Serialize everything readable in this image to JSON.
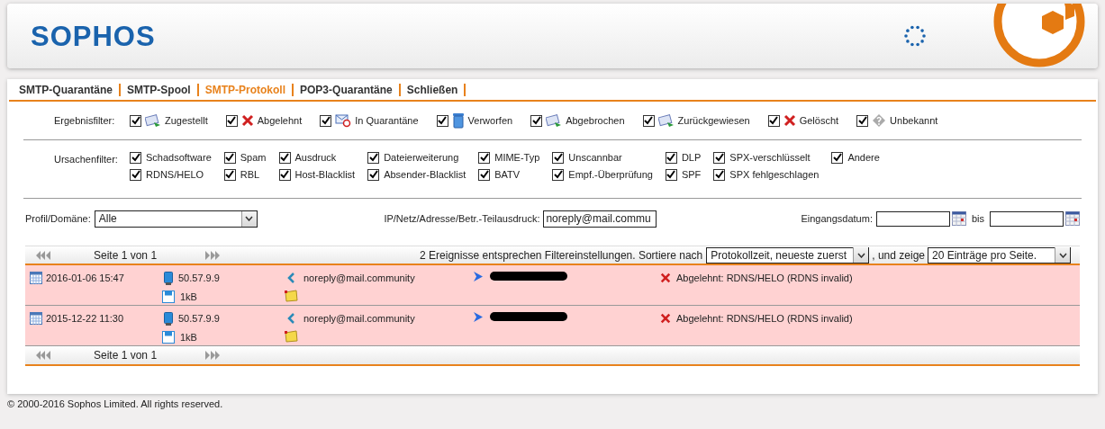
{
  "header": {
    "logo": "SOPHOS"
  },
  "tabs": [
    {
      "label": "SMTP-Quarantäne",
      "selected": false
    },
    {
      "label": "SMTP-Spool",
      "selected": false
    },
    {
      "label": "SMTP-Protokoll",
      "selected": true
    },
    {
      "label": "POP3-Quarantäne",
      "selected": false
    },
    {
      "label": "Schließen",
      "selected": false
    }
  ],
  "result_filter": {
    "label": "Ergebnisfilter:",
    "items": [
      {
        "label": "Zugestellt",
        "checked": true,
        "kind": "envelope"
      },
      {
        "label": "Abgelehnt",
        "checked": true,
        "kind": "cross"
      },
      {
        "label": "In Quarantäne",
        "checked": true,
        "kind": "blocked"
      },
      {
        "label": "Verworfen",
        "checked": true,
        "kind": "bin"
      },
      {
        "label": "Abgebrochen",
        "checked": true,
        "kind": "envelope"
      },
      {
        "label": "Zurückgewiesen",
        "checked": true,
        "kind": "envelope"
      },
      {
        "label": "Gelöscht",
        "checked": true,
        "kind": "cross"
      },
      {
        "label": "Unbekannt",
        "checked": true,
        "kind": "question"
      }
    ]
  },
  "reason_filter": {
    "label": "Ursachenfilter:",
    "columns": [
      [
        {
          "label": "Schadsoftware",
          "checked": true
        },
        {
          "label": "RDNS/HELO",
          "checked": true
        }
      ],
      [
        {
          "label": "Spam",
          "checked": true
        },
        {
          "label": "RBL",
          "checked": true
        }
      ],
      [
        {
          "label": "Ausdruck",
          "checked": true
        },
        {
          "label": "Host-Blacklist",
          "checked": true
        }
      ],
      [
        {
          "label": "Dateierweiterung",
          "checked": true
        },
        {
          "label": "Absender-Blacklist",
          "checked": true
        }
      ],
      [
        {
          "label": "MIME-Typ",
          "checked": true
        },
        {
          "label": "BATV",
          "checked": true
        }
      ],
      [
        {
          "label": "Unscannbar",
          "checked": true
        },
        {
          "label": "Empf.-Überprüfung",
          "checked": true
        }
      ],
      [
        {
          "label": "DLP",
          "checked": true
        },
        {
          "label": "SPF",
          "checked": true
        }
      ],
      [
        {
          "label": "SPX-verschlüsselt",
          "checked": true
        },
        {
          "label": "SPX fehlgeschlagen",
          "checked": true
        }
      ],
      [
        {
          "label": "Andere",
          "checked": true
        }
      ]
    ]
  },
  "search": {
    "profile_label": "Profil/Domäne:",
    "profile_value": "Alle",
    "text_label": "IP/Netz/Adresse/Betr.-Teilausdruck:",
    "text_value": "noreply@mail.commu",
    "date_label": "Eingangsdatum:",
    "date_to_label": "bis"
  },
  "pager_top": {
    "page": "Seite 1 von 1",
    "summary": "2 Ereignisse entsprechen Filtereinstellungen. Sortiere nach",
    "sort_value": "Protokollzeit, neueste zuerst",
    "show_label": ", und zeige",
    "show_value": "20 Einträge pro Seite."
  },
  "rows": [
    {
      "date": "2016-01-06 15:47",
      "ip": "50.57.9.9",
      "size": "1kB",
      "sender": "noreply@mail.community",
      "status": "Abgelehnt: RDNS/HELO (RDNS invalid)"
    },
    {
      "date": "2015-12-22 11:30",
      "ip": "50.57.9.9",
      "size": "1kB",
      "sender": "noreply@mail.community",
      "status": "Abgelehnt: RDNS/HELO (RDNS invalid)"
    }
  ],
  "pager_bottom": {
    "page": "Seite 1 von 1"
  },
  "footer": "© 2000-2016 Sophos Limited. All rights reserved."
}
